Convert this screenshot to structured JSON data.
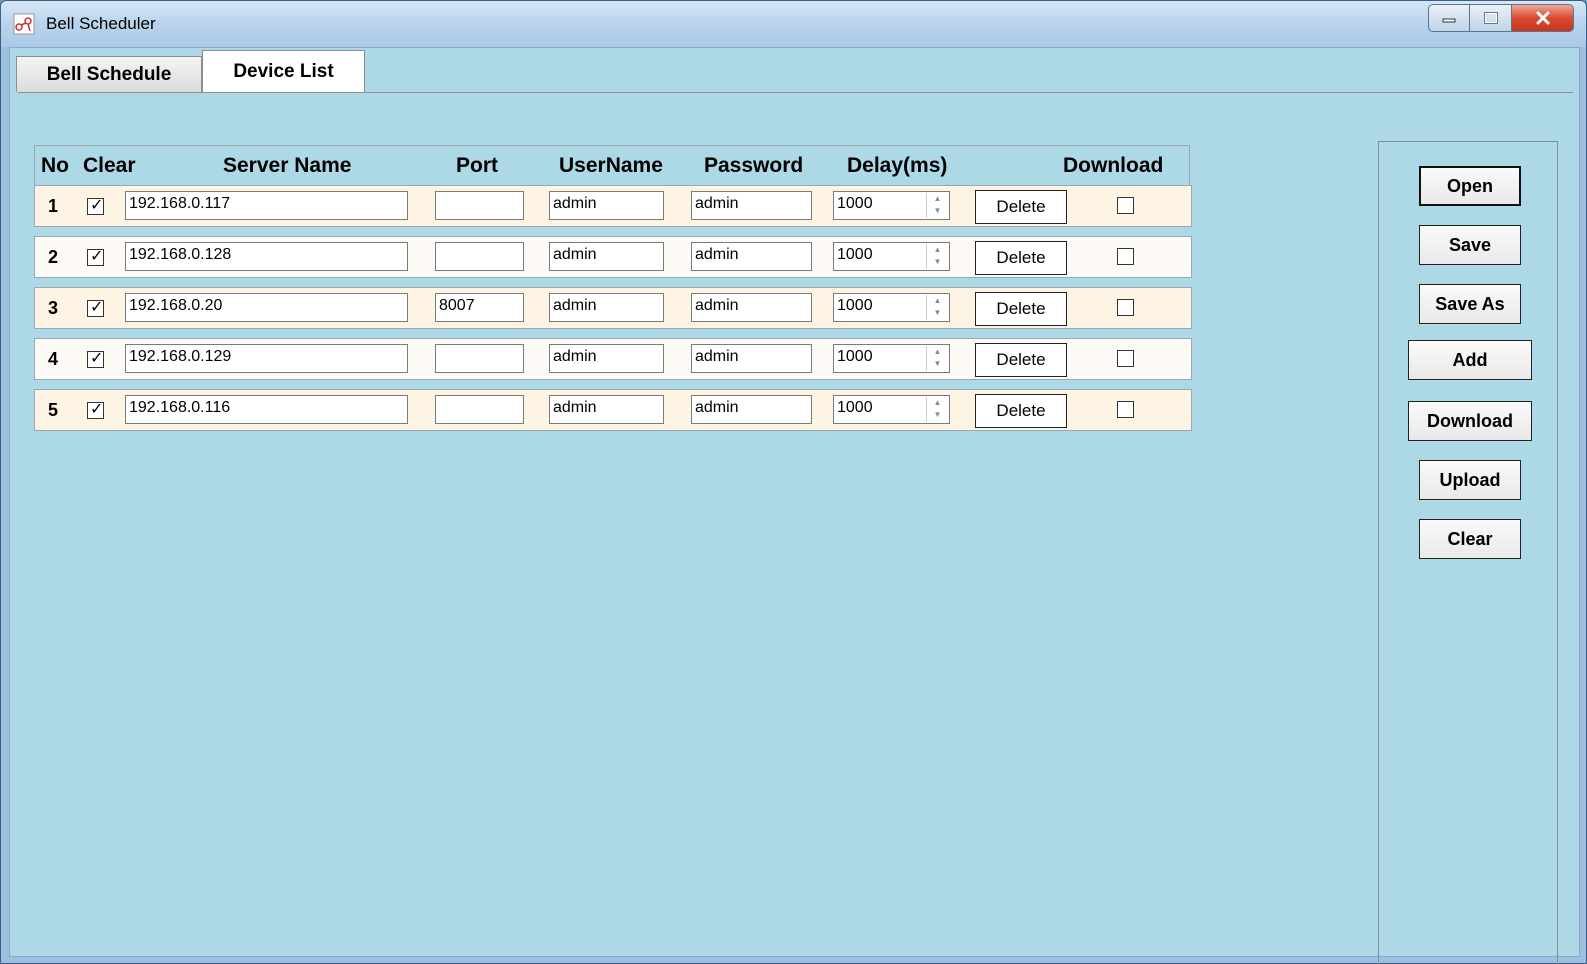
{
  "window": {
    "title": "Bell Scheduler"
  },
  "tabs": [
    {
      "label": "Bell Schedule",
      "active": false
    },
    {
      "label": "Device List",
      "active": true
    }
  ],
  "grid": {
    "headers": {
      "no": "No",
      "clear": "Clear",
      "server": "Server Name",
      "port": "Port",
      "username": "UserName",
      "password": "Password",
      "delay": "Delay(ms)",
      "download": "Download"
    },
    "delete_label": "Delete",
    "rows": [
      {
        "no": "1",
        "clear": true,
        "server": "192.168.0.117",
        "port": "",
        "username": "admin",
        "password": "admin",
        "delay": "1000",
        "download": false
      },
      {
        "no": "2",
        "clear": true,
        "server": "192.168.0.128",
        "port": "",
        "username": "admin",
        "password": "admin",
        "delay": "1000",
        "download": false
      },
      {
        "no": "3",
        "clear": true,
        "server": "192.168.0.20",
        "port": "8007",
        "username": "admin",
        "password": "admin",
        "delay": "1000",
        "download": false
      },
      {
        "no": "4",
        "clear": true,
        "server": "192.168.0.129",
        "port": "",
        "username": "admin",
        "password": "admin",
        "delay": "1000",
        "download": false
      },
      {
        "no": "5",
        "clear": true,
        "server": "192.168.0.116",
        "port": "",
        "username": "admin",
        "password": "admin",
        "delay": "1000",
        "download": false
      }
    ]
  },
  "side_buttons": {
    "open": "Open",
    "save": "Save",
    "save_as": "Save As",
    "add": "Add",
    "download": "Download",
    "upload": "Upload",
    "clear": "Clear"
  },
  "colors": {
    "client_background": "#add8e6",
    "row_odd": "#fdf4e3",
    "row_even": "#fdfaf6",
    "close_button": "#d84a2e"
  }
}
